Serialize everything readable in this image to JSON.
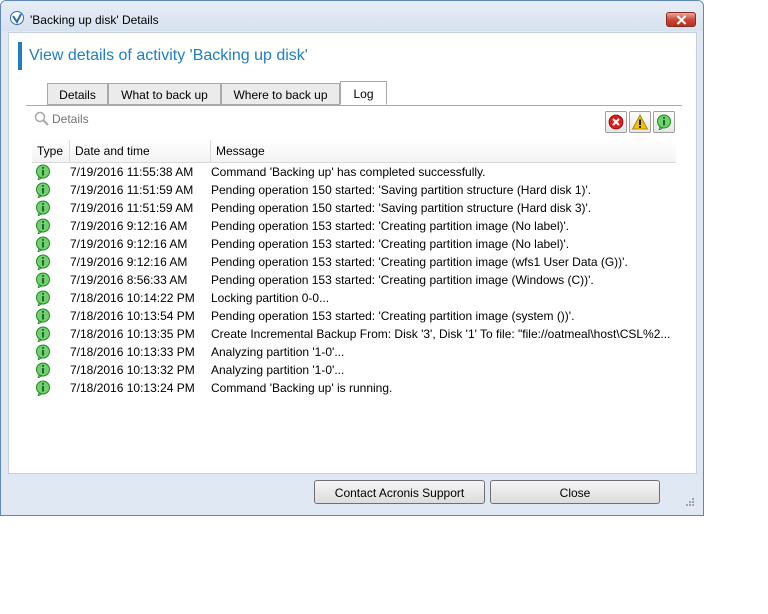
{
  "window": {
    "title": "'Backing up disk' Details"
  },
  "heading": "View details of activity 'Backing up disk'",
  "tabs": [
    {
      "label": "Details"
    },
    {
      "label": "What to back up"
    },
    {
      "label": "Where to back up"
    },
    {
      "label": "Log",
      "active": true
    }
  ],
  "search": {
    "placeholder": "Details"
  },
  "filters": [
    {
      "name": "error-filter"
    },
    {
      "name": "warning-filter"
    },
    {
      "name": "info-filter"
    }
  ],
  "grid": {
    "headers": {
      "type": "Type",
      "datetime": "Date and time",
      "message": "Message"
    },
    "rows": [
      {
        "type": "info",
        "datetime": "7/19/2016 11:55:38 AM",
        "message": "Command 'Backing up' has completed successfully."
      },
      {
        "type": "info",
        "datetime": "7/19/2016 11:51:59 AM",
        "message": "Pending operation 150 started: 'Saving partition structure (Hard disk 1)'."
      },
      {
        "type": "info",
        "datetime": "7/19/2016 11:51:59 AM",
        "message": "Pending operation 150 started: 'Saving partition structure (Hard disk 3)'."
      },
      {
        "type": "info",
        "datetime": "7/19/2016 9:12:16 AM",
        "message": "Pending operation 153 started: 'Creating partition image (No label)'."
      },
      {
        "type": "info",
        "datetime": "7/19/2016 9:12:16 AM",
        "message": "Pending operation 153 started: 'Creating partition image (No label)'."
      },
      {
        "type": "info",
        "datetime": "7/19/2016 9:12:16 AM",
        "message": "Pending operation 153 started: 'Creating partition image (wfs1 User Data (G))'."
      },
      {
        "type": "info",
        "datetime": "7/19/2016 8:56:33 AM",
        "message": "Pending operation 153 started: 'Creating partition image (Windows (C))'."
      },
      {
        "type": "info",
        "datetime": "7/18/2016 10:14:22 PM",
        "message": "Locking partition 0-0..."
      },
      {
        "type": "info",
        "datetime": "7/18/2016 10:13:54 PM",
        "message": "Pending operation 153 started: 'Creating partition image (system ())'."
      },
      {
        "type": "info",
        "datetime": "7/18/2016 10:13:35 PM",
        "message": "Create Incremental Backup  From: Disk '3', Disk '1' To file: \"file://oatmeal\\host\\CSL%2..."
      },
      {
        "type": "info",
        "datetime": "7/18/2016 10:13:33 PM",
        "message": "Analyzing partition '1-0'..."
      },
      {
        "type": "info",
        "datetime": "7/18/2016 10:13:32 PM",
        "message": "Analyzing partition '1-0'..."
      },
      {
        "type": "info",
        "datetime": "7/18/2016 10:13:24 PM",
        "message": "Command 'Backing up' is running."
      }
    ]
  },
  "buttons": {
    "support": "Contact Acronis Support",
    "close": "Close"
  },
  "colors": {
    "accent": "#1e7fc4",
    "info": "#2fae2f",
    "error": "#d81e1e",
    "warning": "#f2c200"
  }
}
